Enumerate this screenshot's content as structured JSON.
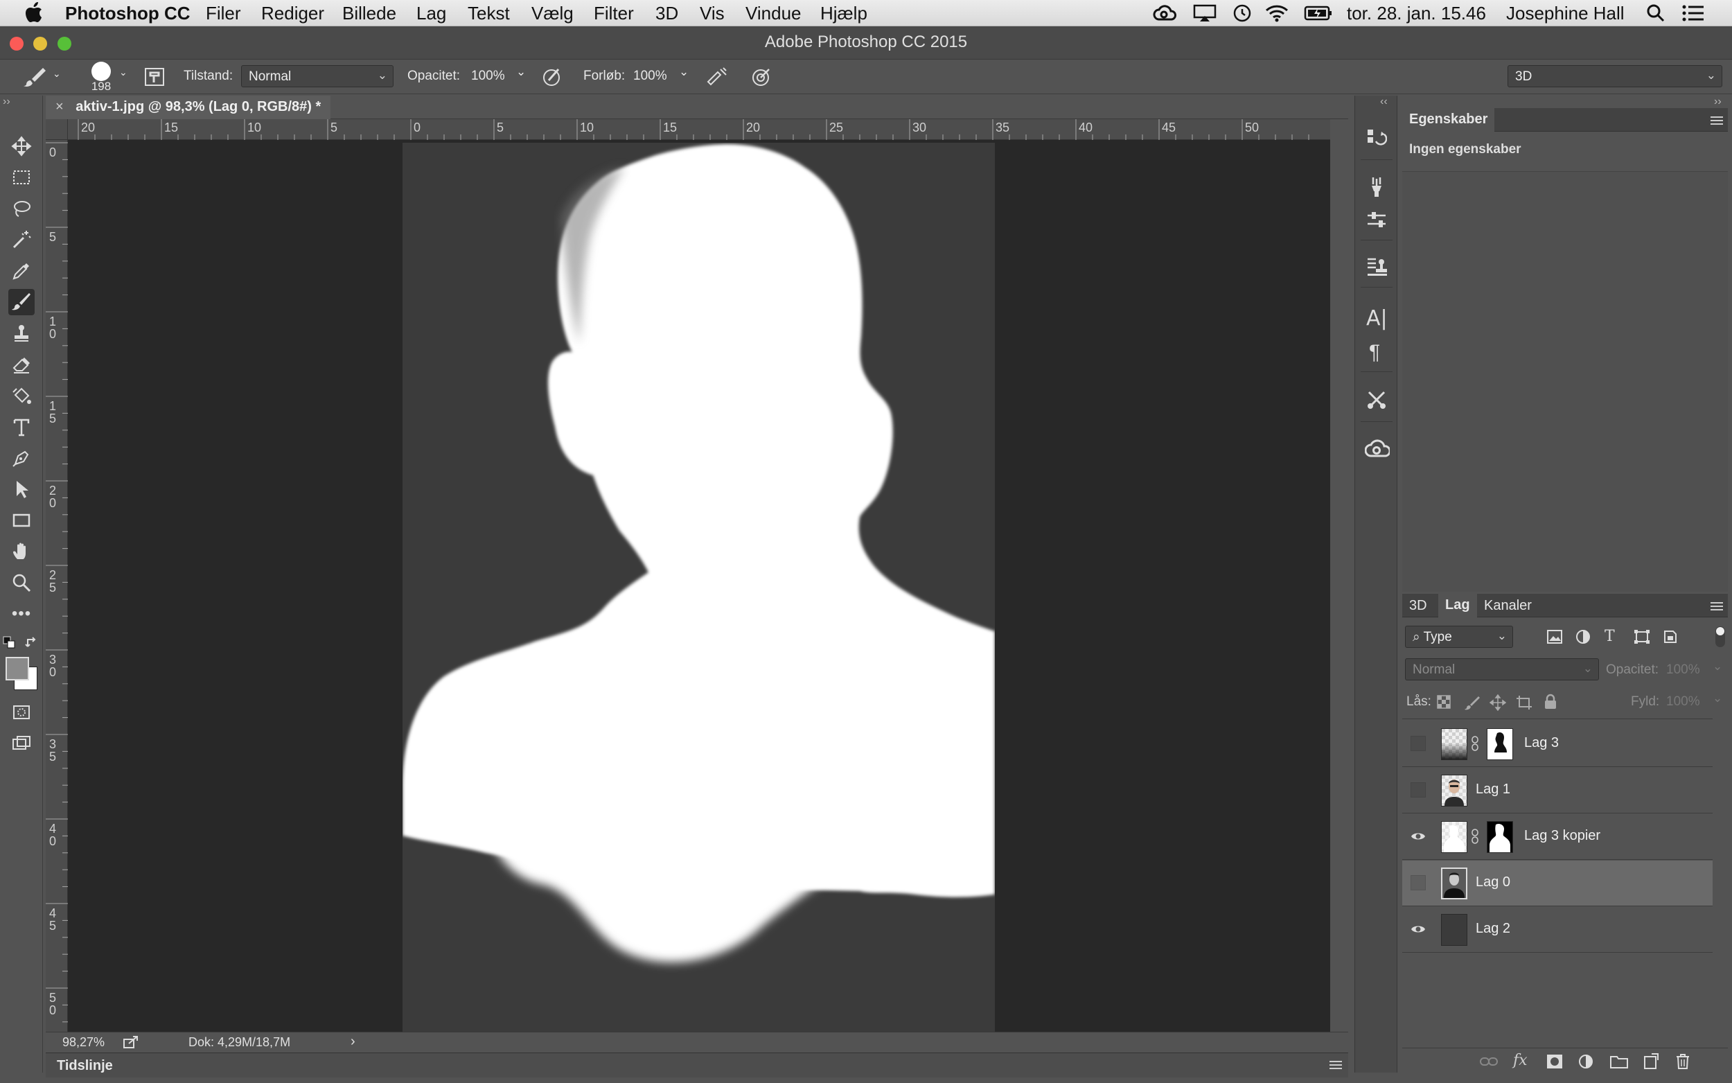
{
  "menubar": {
    "app": "Photoshop CC",
    "items": [
      "Filer",
      "Rediger",
      "Billede",
      "Lag",
      "Tekst",
      "Vælg",
      "Filter",
      "3D",
      "Vis",
      "Vindue",
      "Hjælp"
    ],
    "clock": "tor. 28. jan. 15.46",
    "user": "Josephine Hall"
  },
  "window": {
    "title": "Adobe Photoshop CC 2015"
  },
  "options": {
    "brush_size": "198",
    "mode_label": "Tilstand:",
    "mode_value": "Normal",
    "opacity_label": "Opacitet:",
    "opacity_value": "100%",
    "flow_label": "Forløb:",
    "flow_value": "100%",
    "workspace": "3D"
  },
  "document": {
    "tab_title": "aktiv-1.jpg @ 98,3% (Lag 0, RGB/8#) *",
    "zoom": "98,27%",
    "doc_size": "Dok: 4,29M/18,7M"
  },
  "rulers": {
    "h": [
      "20",
      "15",
      "10",
      "5",
      "0",
      "5",
      "10",
      "15",
      "20",
      "25",
      "30",
      "35",
      "40",
      "45",
      "50"
    ],
    "v": [
      [
        "0"
      ],
      [
        "5"
      ],
      [
        "1",
        "0"
      ],
      [
        "1",
        "5"
      ],
      [
        "2",
        "0"
      ],
      [
        "2",
        "5"
      ],
      [
        "3",
        "0"
      ],
      [
        "3",
        "5"
      ],
      [
        "4",
        "0"
      ],
      [
        "4",
        "5"
      ],
      [
        "5",
        "0"
      ]
    ]
  },
  "timeline": {
    "label": "Tidslinje"
  },
  "properties": {
    "tab": "Egenskaber",
    "empty": "Ingen egenskaber"
  },
  "layers_panel": {
    "tabs": [
      "3D",
      "Lag",
      "Kanaler"
    ],
    "filter": "Type",
    "blend": "Normal",
    "opacity_label": "Opacitet:",
    "opacity_value": "100%",
    "lock_label": "Lås:",
    "fill_label": "Fyld:",
    "fill_value": "100%",
    "layers": [
      {
        "name": "Lag 3",
        "visible": false
      },
      {
        "name": "Lag 1",
        "visible": false
      },
      {
        "name": "Lag 3 kopier",
        "visible": true
      },
      {
        "name": "Lag 0",
        "visible": false
      },
      {
        "name": "Lag 2",
        "visible": true
      }
    ]
  },
  "colors": {
    "accent": "#2d2d2d",
    "canvas_doc": "#3b3b3b",
    "silhouette": "#ffffff"
  }
}
